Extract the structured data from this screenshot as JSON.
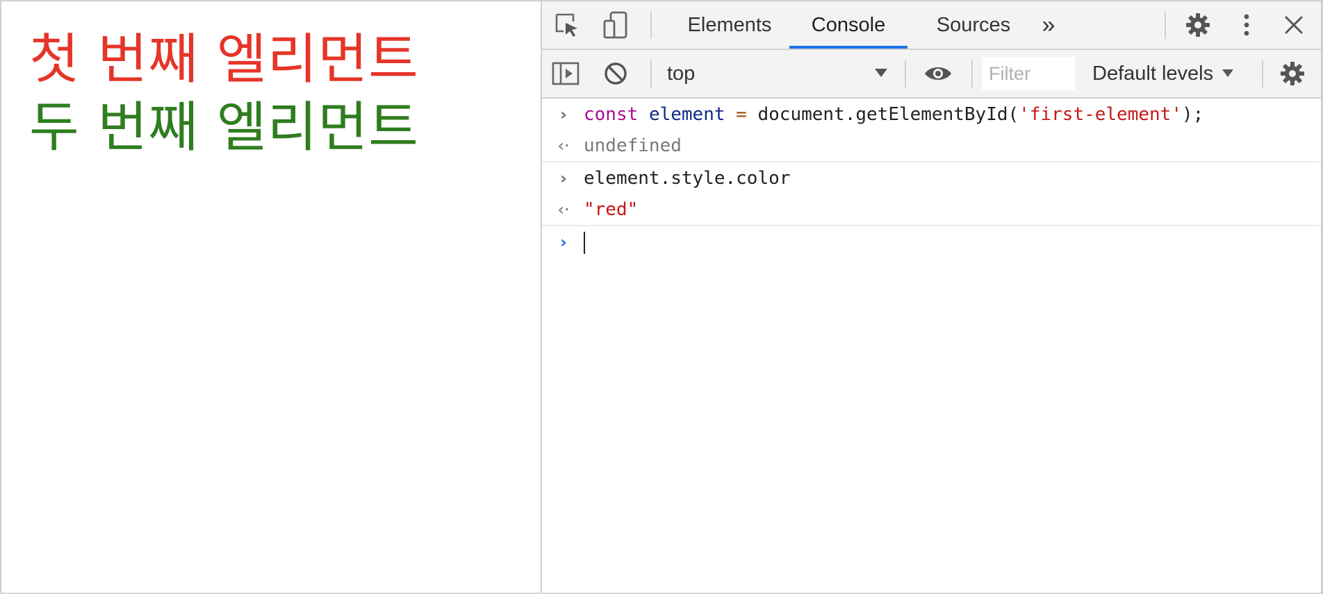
{
  "page": {
    "lines": [
      {
        "text": "첫 번째 엘리먼트",
        "color": "#e53528"
      },
      {
        "text": "두 번째 엘리먼트",
        "color": "#2f7d20"
      }
    ]
  },
  "devtools": {
    "tabs": [
      {
        "label": "Elements",
        "active": false
      },
      {
        "label": "Console",
        "active": true
      },
      {
        "label": "Sources",
        "active": false
      }
    ],
    "more_tabs_glyph": "»",
    "toolbar": {
      "context": "top",
      "filter_placeholder": "Filter",
      "levels_label": "Default levels"
    },
    "console": [
      {
        "type": "input",
        "text": "const element = document.getElementById('first-element');"
      },
      {
        "type": "output",
        "text": "undefined"
      },
      {
        "type": "input",
        "text": "element.style.color"
      },
      {
        "type": "output",
        "text": "\"red\""
      }
    ],
    "icons": [
      "inspect-element-icon",
      "device-toolbar-icon",
      "settings-icon",
      "more-vertical-icon",
      "close-icon",
      "sidebar-toggle-icon",
      "clear-console-icon",
      "eye-icon"
    ],
    "accent_color": "#1a73e8"
  }
}
